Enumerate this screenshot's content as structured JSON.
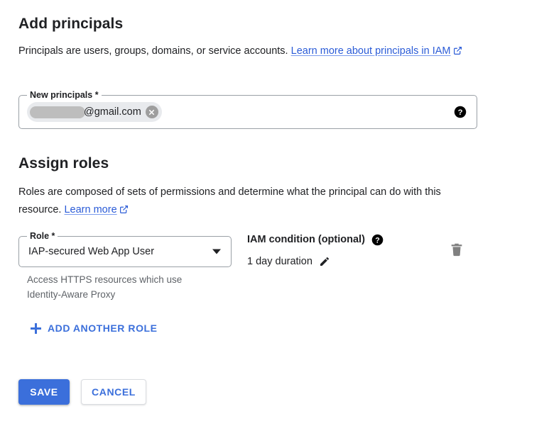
{
  "add_principals": {
    "title": "Add principals",
    "description_lead": "Principals are users, groups, domains, or service accounts.",
    "description_link": "Learn more about principals in IAM",
    "field": {
      "label": "New principals *",
      "chip_text": "@gmail.com",
      "chip_remove_label": "x",
      "help_icon": "help-icon"
    }
  },
  "assign_roles": {
    "title": "Assign roles",
    "description_lead": "Roles are composed of sets of permissions and determine what the principal can do with this resource.",
    "description_link": "Learn more",
    "role": {
      "label": "Role *",
      "value": "IAP-secured Web App User",
      "hint": "Access HTTPS resources which use Identity-Aware Proxy"
    },
    "iam_condition": {
      "label": "IAM condition (optional)",
      "value": "1 day duration",
      "edit_icon": "pencil-icon",
      "help_icon": "help-icon"
    },
    "delete_icon": "trash-icon",
    "add_another_role": "ADD ANOTHER ROLE"
  },
  "footer": {
    "save_label": "SAVE",
    "cancel_label": "CANCEL"
  },
  "colors": {
    "accent_blue": "#3b6fdb",
    "link_blue": "#2a5bd7",
    "text_primary": "#202124",
    "text_secondary": "#5f6368",
    "border": "#9aa0a6",
    "chip_bg": "#e8eaed"
  }
}
